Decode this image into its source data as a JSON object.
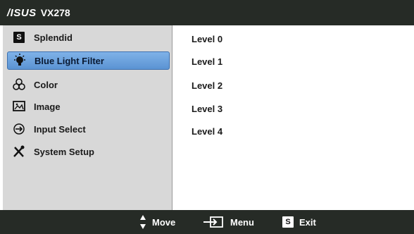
{
  "header": {
    "brand": "/ISUS",
    "model": "VX278"
  },
  "sidebar": {
    "items": [
      {
        "label": "Splendid",
        "icon": "splendid-s-icon",
        "active": false
      },
      {
        "label": "Blue Light Filter",
        "icon": "lightbulb-icon",
        "active": true
      },
      {
        "label": "Color",
        "icon": "color-circles-icon",
        "active": false
      },
      {
        "label": "Image",
        "icon": "image-icon",
        "active": false
      },
      {
        "label": "Input Select",
        "icon": "input-arrow-icon",
        "active": false
      },
      {
        "label": "System Setup",
        "icon": "tools-icon",
        "active": false
      }
    ]
  },
  "content": {
    "levels": [
      "Level 0",
      "Level 1",
      "Level 2",
      "Level 3",
      "Level 4"
    ]
  },
  "footer": {
    "move_label": "Move",
    "menu_label": "Menu",
    "exit_label": "Exit",
    "exit_key": "S"
  },
  "colors": {
    "bar_background": "#262b26",
    "sidebar_background": "#d8d8d8",
    "highlight": "#5b93d3"
  }
}
